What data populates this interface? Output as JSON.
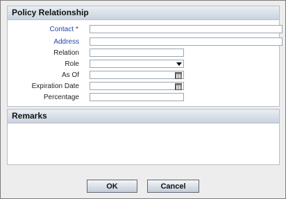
{
  "policy_section": {
    "title": "Policy Relationship",
    "fields": {
      "contact": {
        "label": "Contact",
        "required_mark": "*",
        "value": ""
      },
      "address": {
        "label": "Address",
        "value": ""
      },
      "relation": {
        "label": "Relation",
        "value": ""
      },
      "role": {
        "label": "Role",
        "value": ""
      },
      "as_of": {
        "label": "As Of",
        "value": ""
      },
      "expiration_date": {
        "label": "Expiration Date",
        "value": ""
      },
      "percentage": {
        "label": "Percentage",
        "value": ""
      }
    }
  },
  "remarks_section": {
    "title": "Remarks",
    "value": ""
  },
  "buttons": {
    "ok": "OK",
    "cancel": "Cancel"
  },
  "icons": {
    "role_dropdown": "chevron-down-icon",
    "as_of_picker": "calendar-icon",
    "expiration_picker": "calendar-icon"
  },
  "colors": {
    "link_label": "#2644a6",
    "required": "#c00000",
    "header_gradient_top": "#e9eef4",
    "header_gradient_bottom": "#c9d3de"
  }
}
